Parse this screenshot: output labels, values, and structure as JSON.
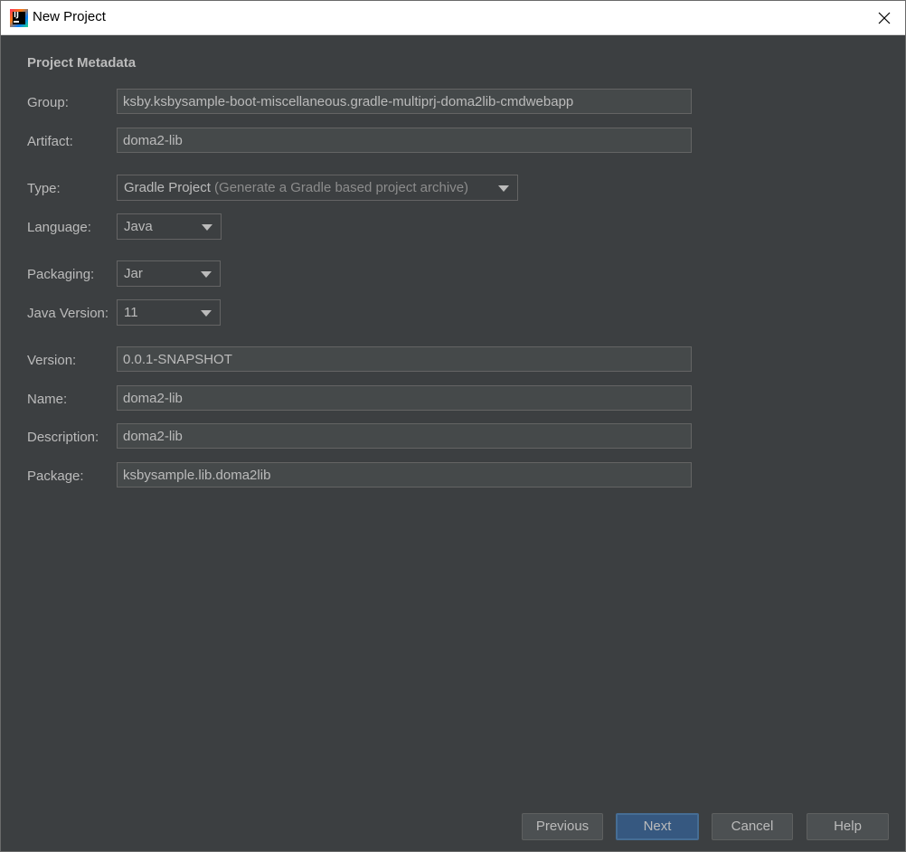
{
  "window": {
    "title": "New Project"
  },
  "metadata": {
    "section_title": "Project Metadata",
    "group": {
      "label": "Group:",
      "value": "ksby.ksbysample-boot-miscellaneous.gradle-multiprj-doma2lib-cmdwebapp"
    },
    "artifact": {
      "label": "Artifact:",
      "value": "doma2-lib"
    },
    "type": {
      "label": "Type:",
      "value": "Gradle Project",
      "hint": "(Generate a Gradle based project archive)"
    },
    "language": {
      "label": "Language:",
      "value": "Java"
    },
    "packaging": {
      "label": "Packaging:",
      "value": "Jar"
    },
    "java_version": {
      "label": "Java Version:",
      "value": "11"
    },
    "version": {
      "label": "Version:",
      "value": "0.0.1-SNAPSHOT"
    },
    "name": {
      "label": "Name:",
      "value": "doma2-lib"
    },
    "description": {
      "label": "Description:",
      "value": "doma2-lib"
    },
    "package": {
      "label": "Package:",
      "value": "ksbysample.lib.doma2lib"
    }
  },
  "buttons": {
    "previous": "Previous",
    "next": "Next",
    "cancel": "Cancel",
    "help": "Help"
  },
  "icons": {
    "app": "intellij-idea-icon",
    "close": "close-icon",
    "dropdown": "chevron-down-icon"
  }
}
